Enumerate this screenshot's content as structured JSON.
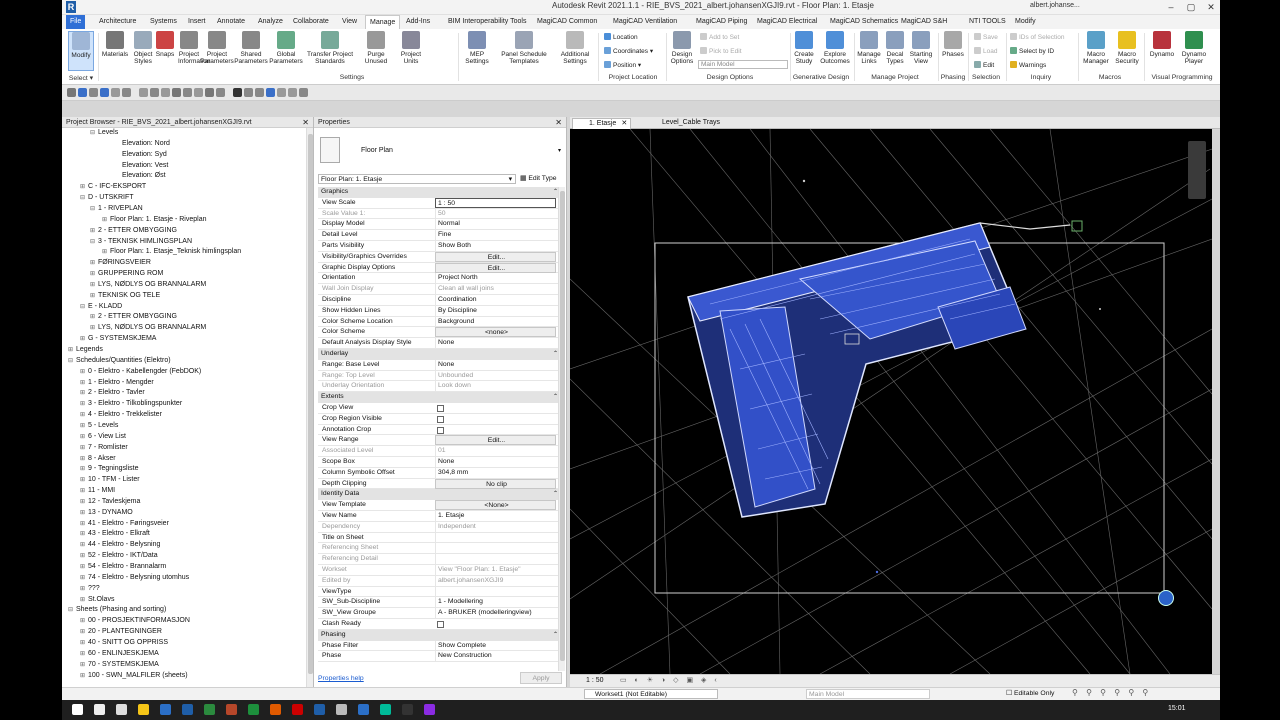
{
  "title": "Autodesk Revit 2021.1.1 - RIE_BVS_2021_albert.johansenXGJI9.rvt - Floor Plan: 1. Etasje",
  "user": "albert.johanse...",
  "tabs": [
    "File",
    "Architecture",
    "Systems",
    "Insert",
    "Annotate",
    "Analyze",
    "Collaborate",
    "View",
    "Manage",
    "Add-Ins",
    "BIM Interoperability Tools",
    "MagiCAD Common",
    "MagiCAD Ventilation",
    "MagiCAD Piping",
    "MagiCAD Electrical",
    "MagiCAD Schematics",
    "MagiCAD S&H",
    "NTI TOOLS",
    "Modify"
  ],
  "ribbon": {
    "modify": "Modify",
    "select": "Select ▾",
    "settings_buttons": [
      "Materials",
      "Object Styles",
      "Snaps",
      "Project Information",
      "Project Parameters",
      "Shared Parameters",
      "Global Parameters",
      "Transfer Project Standards",
      "Purge Unused",
      "Project Units"
    ],
    "settings_label": "Settings",
    "mep": "MEP Settings",
    "panel_schedule": "Panel Schedule Templates",
    "additional": "Additional Settings",
    "location": "Location",
    "coordinates": "Coordinates",
    "position": "Position",
    "project_location": "Project Location",
    "design_options": "Design Options",
    "add_to_set": "Add to Set",
    "pick_to_edit": "Pick to Edit",
    "main_model": "Main Model",
    "design_options_label": "Design Options",
    "create_study": "Create Study",
    "explore_outcomes": "Explore Outcomes",
    "generative_design": "Generative Design",
    "manage_links": "Manage Links",
    "decal_types": "Decal Types",
    "starting_view": "Starting View",
    "manage_project": "Manage Project",
    "phases": "Phases",
    "phasing": "Phasing",
    "save": "Save",
    "load": "Load",
    "edit": "Edit",
    "selection": "Selection",
    "ids_of_selection": "IDs of Selection",
    "select_by_id": "Select by ID",
    "warnings": "Warnings",
    "inquiry": "Inquiry",
    "macro_manager": "Macro Manager",
    "macro_security": "Macro Security",
    "macros": "Macros",
    "dynamo": "Dynamo",
    "dynamo_player": "Dynamo Player",
    "visual_programming": "Visual Programming"
  },
  "project_browser": {
    "title": "Project Browser - RIE_BVS_2021_albert.johansenXGJI9.rvt",
    "items": [
      "Levels",
      "Elevation: Nord",
      "Elevation: Syd",
      "Elevation: Vest",
      "Elevation: Øst",
      "C - IFC-EKSPORT",
      "D - UTSKRIFT",
      "1 - RIVEPLAN",
      "Floor Plan: 1. Etasje - Riveplan",
      "2 - ETTER OMBYGGING",
      "3 - TEKNISK HIMLINGSPLAN",
      "Floor Plan: 1. Etasje_Teknisk himlingsplan",
      "FØRINGSVEIER",
      "GRUPPERING ROM",
      "LYS, NØDLYS OG BRANNALARM",
      "TEKNISK OG TELE",
      "E - KLADD",
      "2 - ETTER OMBYGGING",
      "LYS, NØDLYS OG BRANNALARM",
      "G - SYSTEMSKJEMA",
      "Legends",
      "Schedules/Quantities (Elektro)",
      "0 - Elektro - Kabellengder (FebDOK)",
      "1 - Elektro - Mengder",
      "2 - Elektro - Tavler",
      "3 - Elektro - Tilkoblingspunkter",
      "4 - Elektro - Trekkelister",
      "5 - Levels",
      "6 - View List",
      "7 - Romlister",
      "8 - Akser",
      "9 - Tegningsliste",
      "10 - TFM - Lister",
      "11 - MMI",
      "12 - Tavleskjema",
      "13 - DYNAMO",
      "41 - Elektro - Føringsveier",
      "43 - Elektro - Elkraft",
      "44 - Elektro - Belysning",
      "52 - Elektro - IKT/Data",
      "54 - Elektro - Brannalarm",
      "74 - Elektro - Belysning utomhus",
      "???",
      "St.Olavs",
      "Sheets (Phasing and sorting)",
      "00 - PROSJEKTINFORMASJON",
      "20 - PLANTEGNINGER",
      "40 - SNITT OG OPPRISS",
      "60 - ENLINJESKJEMA",
      "70 - SYSTEMSKJEMA",
      "100 - SWN_MALFILER (sheets)",
      "???"
    ]
  },
  "properties": {
    "title": "Properties",
    "type": "Floor Plan",
    "instance": "Floor Plan: 1. Etasje",
    "edit_type": "Edit Type",
    "groups": {
      "graphics": "Graphics",
      "underlay": "Underlay",
      "extents": "Extents",
      "identity": "Identity Data",
      "phasing": "Phasing"
    },
    "rows": [
      [
        "View Scale",
        "1 : 50"
      ],
      [
        "Scale Value    1:",
        "50"
      ],
      [
        "Display Model",
        "Normal"
      ],
      [
        "Detail Level",
        "Fine"
      ],
      [
        "Parts Visibility",
        "Show Both"
      ],
      [
        "Visibility/Graphics Overrides",
        "Edit..."
      ],
      [
        "Graphic Display Options",
        "Edit..."
      ],
      [
        "Orientation",
        "Project North"
      ],
      [
        "Wall Join Display",
        "Clean all wall joins"
      ],
      [
        "Discipline",
        "Coordination"
      ],
      [
        "Show Hidden Lines",
        "By Discipline"
      ],
      [
        "Color Scheme Location",
        "Background"
      ],
      [
        "Color Scheme",
        "<none>"
      ],
      [
        "Default Analysis Display Style",
        "None"
      ],
      [
        "Range: Base Level",
        "None"
      ],
      [
        "Range: Top Level",
        "Unbounded"
      ],
      [
        "Underlay Orientation",
        "Look down"
      ],
      [
        "Crop View",
        ""
      ],
      [
        "Crop Region Visible",
        ""
      ],
      [
        "Annotation Crop",
        ""
      ],
      [
        "View Range",
        "Edit..."
      ],
      [
        "Associated Level",
        "01"
      ],
      [
        "Scope Box",
        "None"
      ],
      [
        "Column Symbolic Offset",
        "304,8 mm"
      ],
      [
        "Depth Clipping",
        "No clip"
      ],
      [
        "View Template",
        "<None>"
      ],
      [
        "View Name",
        "1. Etasje"
      ],
      [
        "Dependency",
        "Independent"
      ],
      [
        "Title on Sheet",
        ""
      ],
      [
        "Referencing Sheet",
        ""
      ],
      [
        "Referencing Detail",
        ""
      ],
      [
        "Workset",
        "View \"Floor Plan: 1. Etasje\""
      ],
      [
        "Edited by",
        "albert.johansenXGJI9"
      ],
      [
        "ViewType",
        ""
      ],
      [
        "SW_Sub-Discipline",
        "1 - Modellering"
      ],
      [
        "SW_View Groupe",
        "A - BRUKER (modelleringview)"
      ],
      [
        "Clash Ready",
        ""
      ],
      [
        "Phase Filter",
        "Show Complete"
      ],
      [
        "Phase",
        "New Construction"
      ]
    ],
    "help": "Properties help",
    "apply": "Apply"
  },
  "view_tabs": [
    "1. Etasje",
    "Level_Cable Trays"
  ],
  "view_scale": "1 : 50",
  "status": {
    "workset": "Workset1 (Not Editable)",
    "model": "Main Model",
    "editable_only": "Editable Only"
  },
  "clock": "15:01",
  "colors": {
    "accent": "#2f6fd6",
    "plan": "#5a78e8",
    "bg": "#000000"
  }
}
